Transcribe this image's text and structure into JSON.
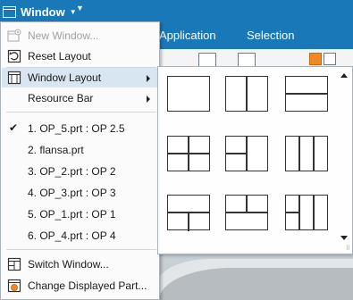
{
  "toolbar": {
    "window_label": "Window",
    "tabs": [
      "Application",
      "Selection"
    ]
  },
  "menu": {
    "items": [
      {
        "label": "New Window...",
        "icon": "new-window-icon",
        "disabled": true
      },
      {
        "label": "Reset Layout",
        "icon": "reset-layout-icon"
      },
      {
        "label": "Window Layout",
        "icon": "window-layout-icon",
        "submenu": true,
        "highlighted": true
      },
      {
        "label": "Resource Bar",
        "submenu": true
      }
    ],
    "recent_parts": [
      {
        "label": "1. OP_5.prt : OP 2.5",
        "checked": true
      },
      {
        "label": "2. flansa.prt"
      },
      {
        "label": "3. OP_2.prt : OP 2"
      },
      {
        "label": "4. OP_3.prt : OP 3"
      },
      {
        "label": "5. OP_1.prt : OP 1"
      },
      {
        "label": "6. OP_4.prt : OP 4"
      }
    ],
    "footer": [
      {
        "label": "Switch Window...",
        "icon": "switch-window-icon"
      },
      {
        "label": "Change Displayed Part...",
        "icon": "change-part-icon"
      }
    ]
  },
  "layouts": [
    "single",
    "two-vertical",
    "two-horizontal",
    "four-grid",
    "three-left-split",
    "three-vertical",
    "three-bottom-split",
    "three-top-split",
    "four-vertical"
  ],
  "colors": {
    "ribbon": "#1978b8",
    "highlight": "#d8e6f2",
    "accent_orange": "#f08a24"
  }
}
